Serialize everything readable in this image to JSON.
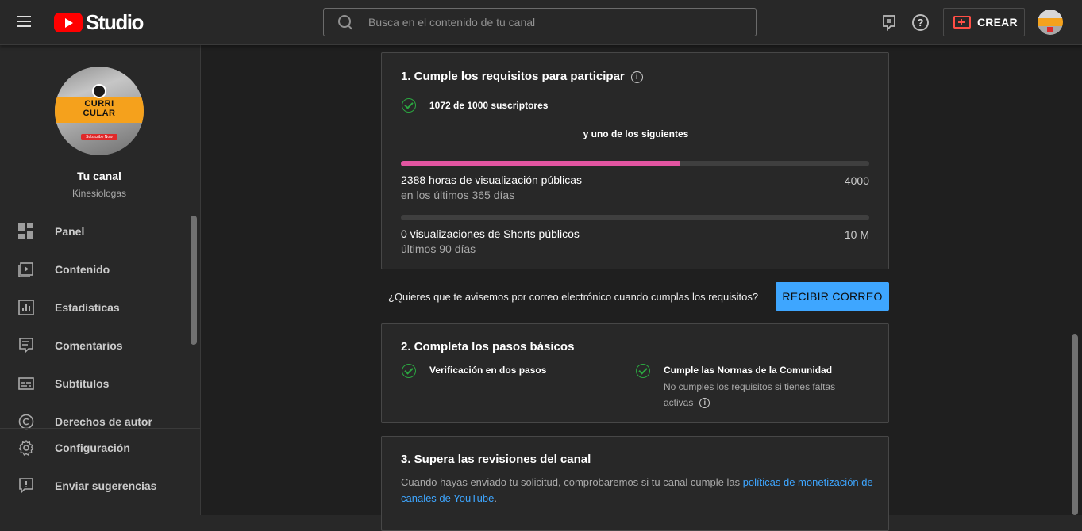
{
  "header": {
    "logo_text": "Studio",
    "search_placeholder": "Busca en el contenido de tu canal",
    "create_label": "CREAR",
    "help_glyph": "?"
  },
  "sidebar": {
    "avatar": {
      "band_line1": "CURRI",
      "band_line2": "CULAR",
      "badge_text": "Subscribe Now"
    },
    "channel_title": "Tu canal",
    "channel_subtitle": "Kinesiologas",
    "items": [
      {
        "label": "Panel",
        "icon": "dashboard-icon"
      },
      {
        "label": "Contenido",
        "icon": "content-icon"
      },
      {
        "label": "Estadísticas",
        "icon": "analytics-icon"
      },
      {
        "label": "Comentarios",
        "icon": "comments-icon"
      },
      {
        "label": "Subtítulos",
        "icon": "subtitles-icon"
      },
      {
        "label": "Derechos de autor",
        "icon": "copyright-icon"
      }
    ],
    "bottom_items": [
      {
        "label": "Configuración",
        "icon": "settings-icon"
      },
      {
        "label": "Enviar sugerencias",
        "icon": "feedback-icon"
      }
    ]
  },
  "requirements": {
    "title": "1. Cumple los requisitos para participar",
    "info_glyph": "i",
    "subscribers_text": "1072 de 1000 suscriptores",
    "one_of_following": "y uno de los siguientes",
    "watch_hours": {
      "label": "2388 horas de visualización públicas",
      "sublabel": "en los últimos 365 días",
      "target": "4000",
      "current_value": 2388,
      "target_value": 4000
    },
    "shorts_views": {
      "label": "0 visualizaciones de Shorts públicos",
      "sublabel": "últimos 90 días",
      "target": "10 M",
      "current_value": 0,
      "target_value": 10000000
    }
  },
  "email_prompt": {
    "question": "¿Quieres que te avisemos por correo electrónico cuando cumplas los requisitos?",
    "button_label": "RECIBIR CORREO"
  },
  "basic_steps": {
    "title": "2. Completa los pasos básicos",
    "step1": "Verificación en dos pasos",
    "step2_title": "Cumple las Normas de la Comunidad",
    "step2_desc": "No cumples los requisitos si tienes faltas activas"
  },
  "review": {
    "title": "3. Supera las revisiones del canal",
    "text_before": "Cuando hayas enviado tu solicitud, comprobaremos si tu canal cumple las ",
    "link_text": "políticas de monetización de canales de YouTube",
    "text_after": "."
  },
  "colors": {
    "accent_blue": "#3ea6ff",
    "progress_pink": "#e255a1",
    "check_green": "#2ba640",
    "youtube_red": "#ff0000"
  }
}
